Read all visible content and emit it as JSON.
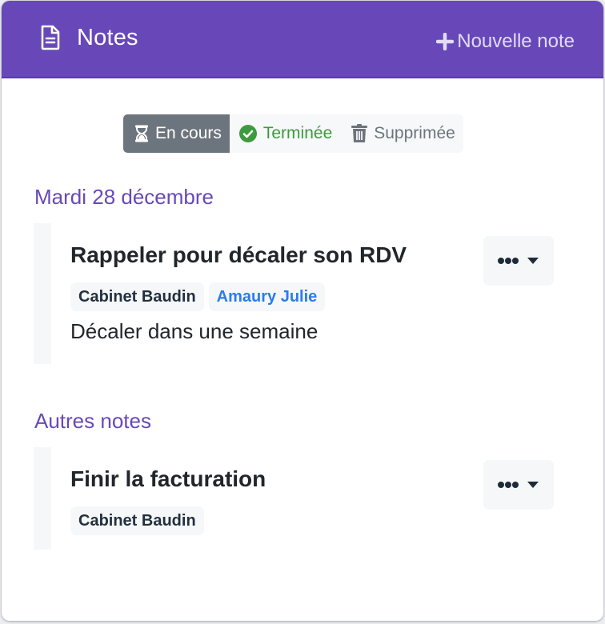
{
  "header": {
    "title": "Notes",
    "title_icon": "file-text-icon",
    "new_note_label": "Nouvelle note",
    "new_note_icon": "plus-icon",
    "background_color": "#6848b9"
  },
  "filters": [
    {
      "label": "En cours",
      "icon": "hourglass-icon",
      "active": true,
      "color": "#6c757d"
    },
    {
      "label": "Terminée",
      "icon": "check-circle-icon",
      "active": false,
      "color": "#3d9a3d"
    },
    {
      "label": "Supprimée",
      "icon": "trash-icon",
      "active": false,
      "color": "#6c757d"
    }
  ],
  "sections": [
    {
      "title": "Mardi 28 décembre",
      "notes": [
        {
          "title": "Rappeler pour décaler son RDV",
          "tags": [
            {
              "label": "Cabinet Baudin",
              "type": "company"
            },
            {
              "label": "Amaury Julie",
              "type": "person"
            }
          ],
          "body": "Décaler dans une semaine",
          "menu_icon": "ellipsis-icon"
        }
      ]
    },
    {
      "title": "Autres notes",
      "notes": [
        {
          "title": "Finir la facturation",
          "tags": [
            {
              "label": "Cabinet Baudin",
              "type": "company"
            }
          ],
          "menu_icon": "ellipsis-icon"
        }
      ]
    }
  ],
  "colors": {
    "accent": "#6848b9",
    "person_tag": "#2b7ce9",
    "text": "#22262a"
  }
}
